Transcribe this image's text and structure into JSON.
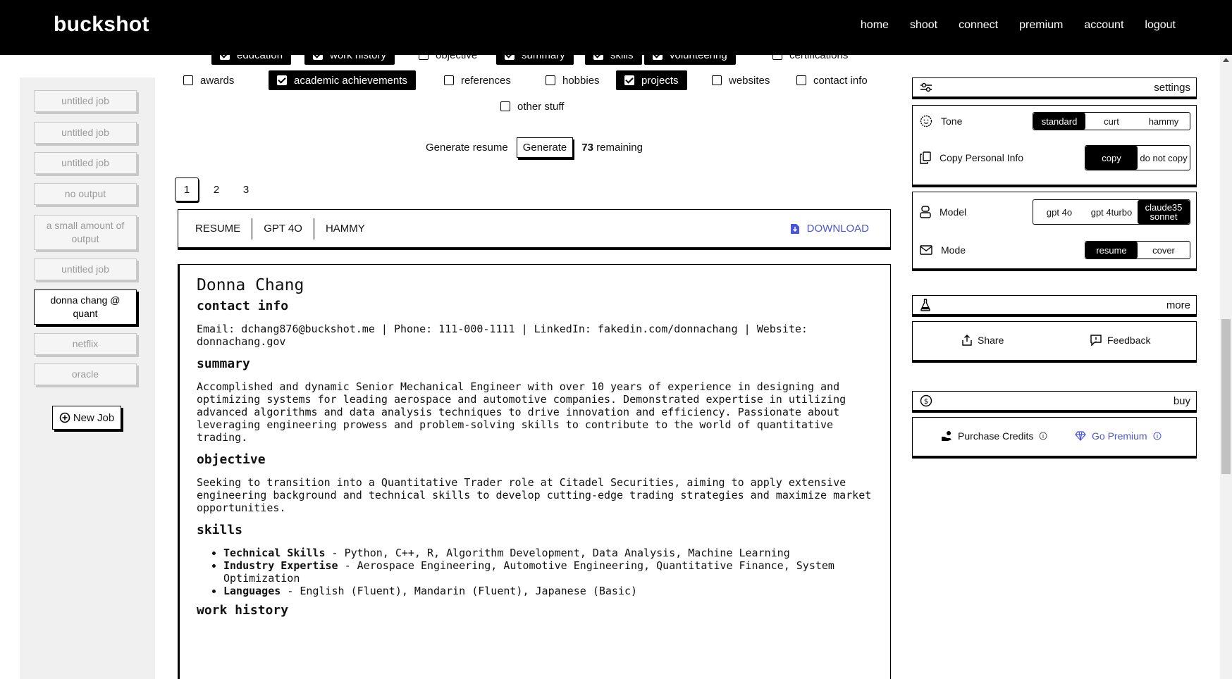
{
  "brand": "buckshot",
  "nav": [
    "home",
    "shoot",
    "connect",
    "premium",
    "account",
    "logout"
  ],
  "jobs": [
    "untitled job",
    "untitled job",
    "untitled job",
    "no output",
    "a small amount of output",
    "untitled job",
    "donna chang @ quant",
    "netflix",
    "oracle"
  ],
  "new_job": "New Job",
  "sections": {
    "row1": [
      {
        "label": "education",
        "checked": true
      },
      {
        "label": "work history",
        "checked": true
      },
      {
        "label": "objective",
        "checked": false
      },
      {
        "label": "summary",
        "checked": true
      },
      {
        "label": "skills",
        "checked": true
      },
      {
        "label": "volunteering",
        "checked": true
      },
      {
        "label": "certifications",
        "checked": false
      }
    ],
    "row2": [
      {
        "label": "awards",
        "checked": false
      },
      {
        "label": "academic achievements",
        "checked": true
      },
      {
        "label": "references",
        "checked": false
      },
      {
        "label": "hobbies",
        "checked": false
      },
      {
        "label": "projects",
        "checked": true
      },
      {
        "label": "websites",
        "checked": false
      },
      {
        "label": "contact info",
        "checked": false
      }
    ],
    "row3": [
      {
        "label": "other stuff",
        "checked": false
      }
    ]
  },
  "generate": {
    "label": "Generate resume",
    "button": "Generate",
    "remaining_count": "73",
    "remaining_text": "remaining"
  },
  "pages": [
    "1",
    "2",
    "3"
  ],
  "infobar": {
    "type": "RESUME",
    "model": "GPT 4O",
    "tone": "HAMMY",
    "download": "DOWNLOAD"
  },
  "resume": {
    "name": "Donna Chang",
    "contact_heading": "contact info",
    "contact": "Email: dchang876@buckshot.me | Phone: 111-000-1111 | LinkedIn: fakedin.com/donnachang | Website: donnachang.gov",
    "summary_heading": "summary",
    "summary": "Accomplished and dynamic Senior Mechanical Engineer with over 10 years of experience in designing and optimizing systems for leading aerospace and automotive companies. Demonstrated expertise in utilizing advanced algorithms and data analysis techniques to drive innovation and efficiency. Passionate about leveraging engineering prowess and problem-solving skills to contribute to the world of quantitative trading.",
    "objective_heading": "objective",
    "objective": "Seeking to transition into a Quantitative Trader role at Citadel Securities, aiming to apply extensive engineering background and technical skills to develop cutting-edge trading strategies and maximize market opportunities.",
    "skills_heading": "skills",
    "skills": [
      {
        "title": "Technical Skills",
        "text": " - Python, C++, R, Algorithm Development, Data Analysis, Machine Learning"
      },
      {
        "title": "Industry Expertise",
        "text": " - Aerospace Engineering, Automotive Engineering, Quantitative Finance, System Optimization"
      },
      {
        "title": "Languages",
        "text": " - English (Fluent), Mandarin (Fluent), Japanese (Basic)"
      }
    ],
    "work_heading": "work history"
  },
  "settings": {
    "title": "settings",
    "tone_label": "Tone",
    "tone_options": [
      "standard",
      "curt",
      "hammy"
    ],
    "tone_selected": "standard",
    "copy_label": "Copy Personal Info",
    "copy_options": [
      "copy",
      "do not copy"
    ],
    "copy_selected": "copy",
    "model_label": "Model",
    "model_options": [
      "gpt 4o",
      "gpt 4turbo",
      "claude35 sonnet"
    ],
    "model_selected": "claude35 sonnet",
    "mode_label": "Mode",
    "mode_options": [
      "resume",
      "cover"
    ],
    "mode_selected": "resume"
  },
  "more": {
    "title": "more",
    "share": "Share",
    "feedback": "Feedback"
  },
  "buy": {
    "title": "buy",
    "purchase": "Purchase Credits",
    "premium": "Go Premium"
  },
  "colors": {
    "accent": "#4a55d6",
    "bar": "#000000"
  }
}
